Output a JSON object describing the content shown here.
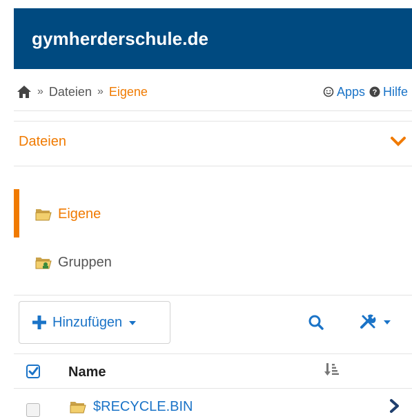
{
  "header": {
    "title": "gymherderschule.de"
  },
  "breadcrumb": {
    "home_icon": "home-icon",
    "separator": "»",
    "items": [
      "Dateien",
      "Eigene"
    ],
    "apps_label": "Apps",
    "help_label": "Hilfe"
  },
  "section": {
    "title": "Dateien",
    "chevron_icon": "chevron-down-icon"
  },
  "nav": [
    {
      "label": "Eigene",
      "icon": "folder-open-icon",
      "active": true
    },
    {
      "label": "Gruppen",
      "icon": "group-folder-icon",
      "active": false
    }
  ],
  "toolbar": {
    "add_label": "Hinzufügen",
    "search_icon": "search-icon",
    "tools_icon": "tools-icon"
  },
  "table": {
    "name_header": "Name",
    "rows": [
      {
        "name": "$RECYCLE.BIN",
        "type": "folder"
      }
    ]
  },
  "colors": {
    "header": "#004a80",
    "accent": "#f07a00",
    "link": "#1a73c7"
  }
}
